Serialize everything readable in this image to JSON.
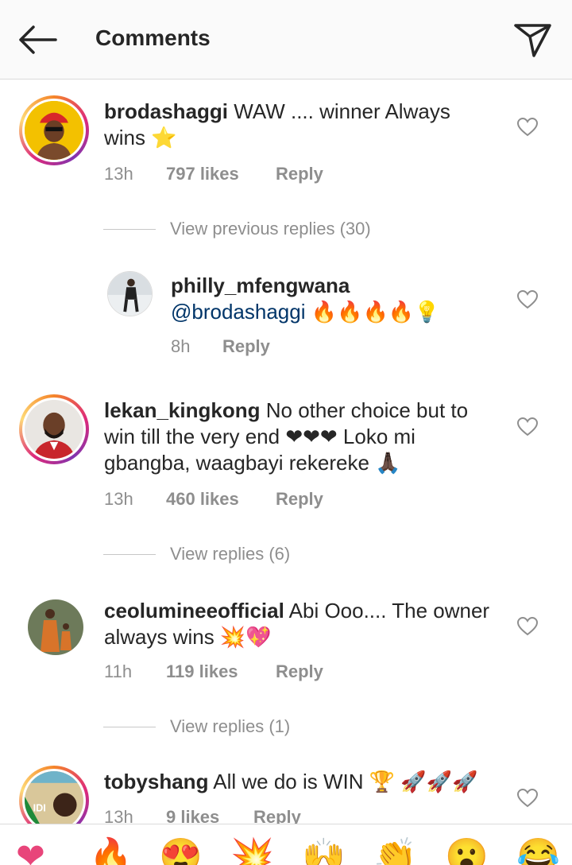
{
  "header": {
    "title": "Comments"
  },
  "comments": [
    {
      "username": "brodashaggi",
      "text": "WAW .... winner Always wins ⭐",
      "time": "13h",
      "likes": "797 likes",
      "reply": "Reply",
      "view_replies": "View previous replies (30)",
      "reply_item": {
        "username": "philly_mfengwana",
        "mention": "@brodashaggi",
        "emojis": "🔥🔥🔥🔥💡",
        "time": "8h",
        "reply": "Reply"
      }
    },
    {
      "username": "lekan_kingkong",
      "text": "No other choice but to win till the very end ❤❤❤ Loko mi gbangba, waagbayi rekereke 🙏🏿",
      "time": "13h",
      "likes": "460 likes",
      "reply": "Reply",
      "view_replies": "View replies (6)"
    },
    {
      "username": "ceolumineeofficial",
      "text": "Abi Ooo.... The owner always wins 💥💖",
      "time": "11h",
      "likes": "119 likes",
      "reply": "Reply",
      "view_replies": "View replies (1)"
    },
    {
      "username": "tobyshang",
      "text": "All we do is WIN 🏆 🚀🚀🚀",
      "time": "13h",
      "likes": "9 likes",
      "reply": "Reply",
      "avatar_text": "IDI"
    }
  ],
  "emoji_bar": [
    "❤",
    "🔥",
    "😍",
    "💥",
    "🙌",
    "👏",
    "😮",
    "😂"
  ],
  "colors": {
    "ring_start": "#f58529",
    "ring_mid": "#dd2a7b",
    "meta_gray": "#8e8e8e",
    "mention_blue": "#003569"
  }
}
